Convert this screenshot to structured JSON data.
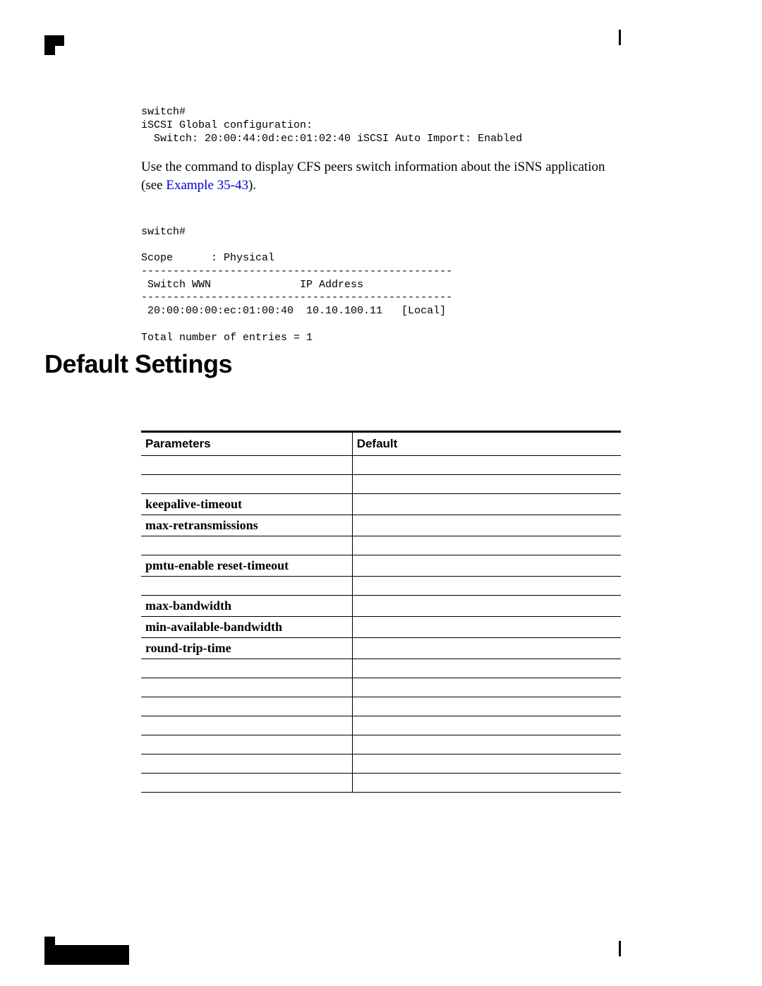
{
  "code1": "switch#\niSCSI Global configuration:\n  Switch: 20:00:44:0d:ec:01:02:40 iSCSI Auto Import: Enabled",
  "prose": {
    "lead": "Use the ",
    "mid": " command to display CFS peers switch information about the iSNS application (see ",
    "linkText": "Example 35-43",
    "tail": ")."
  },
  "code2": "switch#\n\nScope      : Physical\n-------------------------------------------------\n Switch WWN              IP Address\n-------------------------------------------------\n 20:00:00:00:ec:01:00:40  10.10.100.11   [Local]\n\nTotal number of entries = 1",
  "heading": "Default Settings",
  "table": {
    "headers": [
      "Parameters",
      "Default"
    ],
    "rows": [
      {
        "param": "",
        "default": ""
      },
      {
        "param": "",
        "default": ""
      },
      {
        "param": "keepalive-timeout",
        "bold": true,
        "default": ""
      },
      {
        "param": "max-retransmissions",
        "bold": true,
        "default": ""
      },
      {
        "param": "",
        "default": ""
      },
      {
        "param": "pmtu-enable reset-timeout",
        "bold": true,
        "default": ""
      },
      {
        "param": "",
        "default": ""
      },
      {
        "param": "max-bandwidth",
        "bold": true,
        "default": ""
      },
      {
        "param": "min-available-bandwidth",
        "bold": true,
        "default": ""
      },
      {
        "param": "round-trip-time",
        "bold": true,
        "default": ""
      },
      {
        "param": "",
        "default": ""
      },
      {
        "param": "",
        "default": ""
      },
      {
        "param": "",
        "default": ""
      },
      {
        "param": "",
        "default": ""
      },
      {
        "param": "",
        "default": ""
      },
      {
        "param": "",
        "default": ""
      },
      {
        "param": "",
        "default": ""
      }
    ]
  }
}
